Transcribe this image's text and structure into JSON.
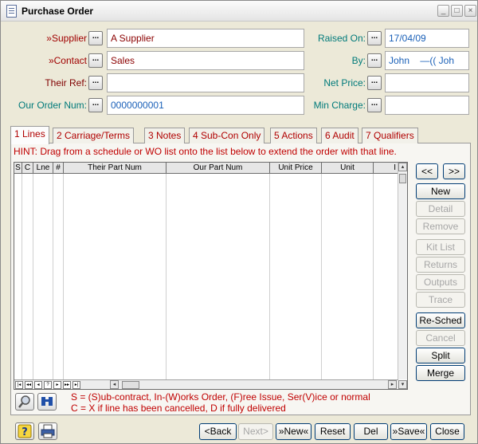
{
  "window": {
    "title": "Purchase Order",
    "controls": {
      "minimize": "_",
      "maximize": "□",
      "close": "×"
    }
  },
  "form": {
    "ellipsis": "...",
    "supplier": {
      "label": "»Supplier",
      "value": "A Supplier"
    },
    "contact": {
      "label": "»Contact",
      "value": "Sales"
    },
    "their_ref": {
      "label": "Their Ref:",
      "value": ""
    },
    "our_order_num": {
      "label": "Our Order Num:",
      "value": "0000000001"
    },
    "raised_on": {
      "label": "Raised On:",
      "value": "17/04/09"
    },
    "by": {
      "label": "By:",
      "value": "John    —(( Joh"
    },
    "net_price": {
      "label": "Net Price:",
      "value": ""
    },
    "min_charge": {
      "label": "Min Charge:",
      "value": ""
    }
  },
  "tabs": [
    {
      "label": "1 Lines"
    },
    {
      "label": "2 Carriage/Terms"
    },
    {
      "label": "3 Notes"
    },
    {
      "label": "4 Sub-Con Only"
    },
    {
      "label": "5 Actions"
    },
    {
      "label": "6 Audit"
    },
    {
      "label": "7 Qualifiers"
    }
  ],
  "hint": "HINT: Drag from a schedule or WO list onto the list below to extend the order with that line.",
  "grid": {
    "columns": [
      "S",
      "C",
      "Lne",
      "#",
      "Their Part Num",
      "Our Part Num",
      "Unit Price",
      "Unit",
      "I"
    ],
    "nav": [
      "|◂",
      "◂◂",
      "◂",
      "?",
      "▸",
      "▸▸",
      "▸|"
    ],
    "scroll": {
      "left": "◂",
      "right": "▸",
      "up": "▴",
      "down": "▾"
    }
  },
  "side_buttons": {
    "prev": "<<",
    "next": ">>",
    "new": "New",
    "detail": "Detail",
    "remove": "Remove",
    "kit_list": "Kit List",
    "returns": "Returns",
    "outputs": "Outputs",
    "trace": "Trace",
    "re_sched": "Re-Sched",
    "cancel": "Cancel",
    "split": "Split",
    "merge": "Merge"
  },
  "legend": {
    "line1": "S = (S)ub-contract, In-(W)orks Order, (F)ree Issue, Ser(V)ice or normal",
    "line2": "C = X if line has been cancelled, D if fully delivered"
  },
  "bottom_buttons": {
    "back": "<Back",
    "next": "Next>",
    "new": "»New«",
    "reset": "Reset",
    "del": "Del",
    "save": "»Save«",
    "close": "Close"
  },
  "colors": {
    "accent_red": "#c00000",
    "label_teal": "#007a7a",
    "value_blue": "#1a60b8"
  }
}
